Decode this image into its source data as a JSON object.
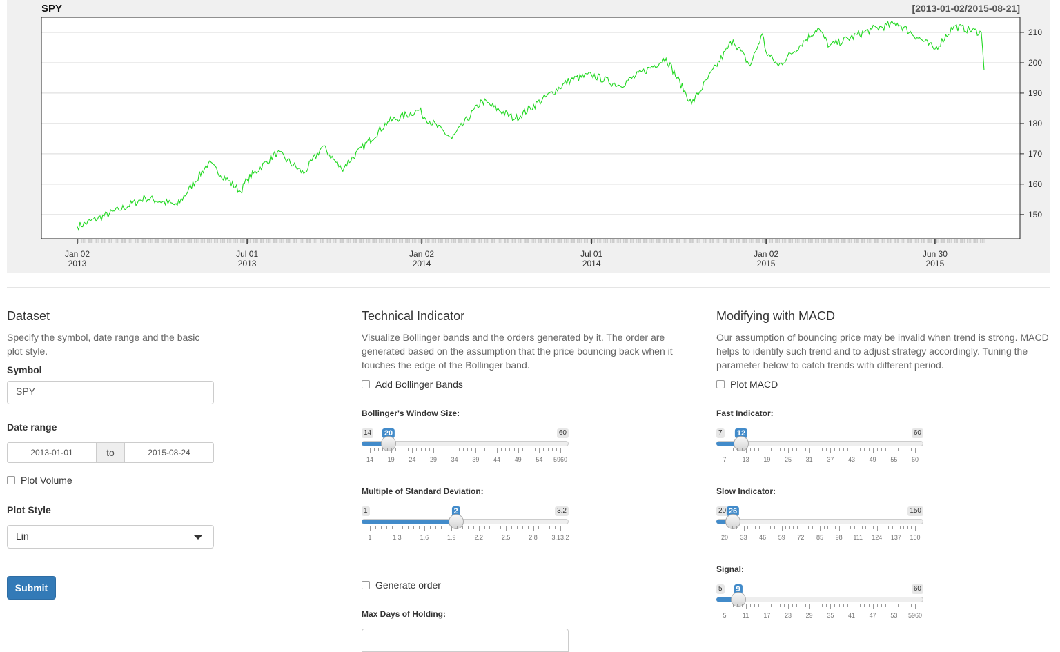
{
  "chart": {
    "title": "SPY",
    "range": "[2013-01-02/2015-08-21]",
    "line_color": "#22d822",
    "y_ticks": [
      "150",
      "160",
      "170",
      "180",
      "190",
      "200",
      "210"
    ],
    "x_ticks": [
      {
        "line1": "Jan 02",
        "line2": "2013"
      },
      {
        "line1": "Jul 01",
        "line2": "2013"
      },
      {
        "line1": "Jan 02",
        "line2": "2014"
      },
      {
        "line1": "Jul 01",
        "line2": "2014"
      },
      {
        "line1": "Jan 02",
        "line2": "2015"
      },
      {
        "line1": "Jun 30",
        "line2": "2015"
      }
    ]
  },
  "chart_data": {
    "type": "line",
    "title": "SPY",
    "subtitle": "[2013-01-02/2015-08-21]",
    "ylim": [
      142,
      215
    ],
    "x": [
      "2013-01-02",
      "2013-02-15",
      "2013-03-15",
      "2013-04-18",
      "2013-05-21",
      "2013-06-24",
      "2013-07-01",
      "2013-08-02",
      "2013-08-30",
      "2013-09-19",
      "2013-10-09",
      "2013-11-27",
      "2013-12-31",
      "2014-01-02",
      "2014-02-03",
      "2014-03-07",
      "2014-04-11",
      "2014-06-09",
      "2014-07-01",
      "2014-07-31",
      "2014-09-18",
      "2014-10-15",
      "2014-11-28",
      "2014-12-16",
      "2014-12-29",
      "2015-01-02",
      "2015-01-15",
      "2015-02-26",
      "2015-03-10",
      "2015-04-24",
      "2015-05-21",
      "2015-06-30",
      "2015-07-20",
      "2015-08-18",
      "2015-08-21"
    ],
    "series": [
      {
        "values": [
          146.0,
          151.5,
          155.5,
          153.0,
          167.0,
          157.5,
          161.5,
          170.5,
          163.5,
          172.5,
          165.0,
          180.5,
          184.5,
          183.0,
          175.0,
          187.5,
          181.5,
          194.5,
          196.0,
          192.5,
          201.5,
          186.5,
          207.5,
          199.0,
          209.5,
          203.5,
          199.0,
          211.5,
          205.5,
          211.0,
          213.0,
          204.5,
          212.0,
          210.0,
          197.5
        ]
      }
    ]
  },
  "dataset": {
    "title": "Dataset",
    "desc": "Specify the symbol, date range and the basic plot style.",
    "symbol_label": "Symbol",
    "symbol_value": "SPY",
    "date_label": "Date range",
    "date_start": "2013-01-01",
    "date_to": "to",
    "date_end": "2015-08-24",
    "volume_label": "Plot Volume",
    "style_label": "Plot Style",
    "style_value": "Lin",
    "submit": "Submit"
  },
  "technical": {
    "title": "Technical Indicator",
    "desc": "Visualize Bollinger bands and the orders generated by it. The order are generated based on the assumption that the price bouncing back when it touches the edge of the Bollinger band.",
    "bands_label": "Add Bollinger Bands",
    "window_label": "Bollinger's Window Size:",
    "window": {
      "min": "14",
      "max": "60",
      "value": "20",
      "fraction": 0.13,
      "ticks": [
        "14",
        "19",
        "24",
        "29",
        "34",
        "39",
        "44",
        "49",
        "54",
        "5960"
      ]
    },
    "stdev_label": "Multiple of Standard Deviation:",
    "stdev": {
      "min": "1",
      "max": "3.2",
      "value": "2",
      "fraction": 0.455,
      "ticks": [
        "1",
        "1.3",
        "1.6",
        "1.9",
        "2.2",
        "2.5",
        "2.8",
        "3.13.2"
      ]
    },
    "order_label": "Generate order",
    "hold_label": "Max Days of Holding:"
  },
  "macd": {
    "title": "Modifying with MACD",
    "desc": "Our assumption of bouncing price may be invalid when trend is strong. MACD helps to identify such trend and to adjust strategy accordingly. Tuning the parameter below to catch trends with different period.",
    "plot_label": "Plot MACD",
    "fast_label": "Fast Indicator:",
    "fast": {
      "min": "7",
      "max": "60",
      "value": "12",
      "fraction": 0.12,
      "ticks": [
        "7",
        "13",
        "19",
        "25",
        "31",
        "37",
        "43",
        "49",
        "55",
        "60"
      ]
    },
    "slow_label": "Slow Indicator:",
    "slow": {
      "min": "20",
      "max": "150",
      "value": "26",
      "fraction": 0.08,
      "ticks": [
        "20",
        "33",
        "46",
        "59",
        "72",
        "85",
        "98",
        "111",
        "124",
        "137",
        "150"
      ]
    },
    "signal_label": "Signal:",
    "signal": {
      "min": "5",
      "max": "60",
      "value": "9",
      "fraction": 0.105,
      "ticks": [
        "5",
        "11",
        "17",
        "23",
        "29",
        "35",
        "41",
        "47",
        "53",
        "5960"
      ]
    }
  }
}
